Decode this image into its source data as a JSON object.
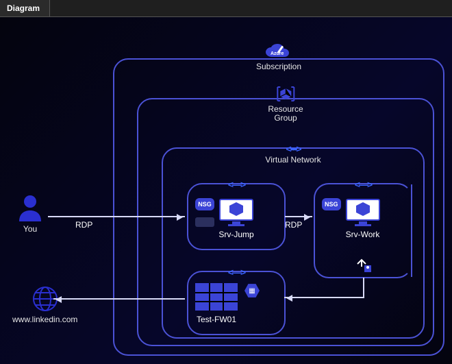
{
  "tab_label": "Diagram",
  "subscription": {
    "label": "Subscription",
    "icon": "cloud-pencil-icon",
    "brand": "Azure"
  },
  "resource_group": {
    "label": "Resource\nGroup",
    "icon": "cube-bracket-icon"
  },
  "vnet": {
    "label": "Virtual Network",
    "icon": "subnet-arrows-icon"
  },
  "subnets": {
    "jump": {
      "vm_name": "Srv-Jump",
      "nsg_label": "NSG"
    },
    "work": {
      "vm_name": "Srv-Work",
      "nsg_label": "NSG"
    },
    "fw": {
      "fw_name": "Test-FW01"
    }
  },
  "external": {
    "user_label": "You",
    "web_label": "www.linkedin.com"
  },
  "connections": {
    "user_to_jump": {
      "label": "RDP"
    },
    "jump_to_work": {
      "label": "RDP"
    }
  },
  "colors": {
    "accent": "#4b52d6"
  }
}
